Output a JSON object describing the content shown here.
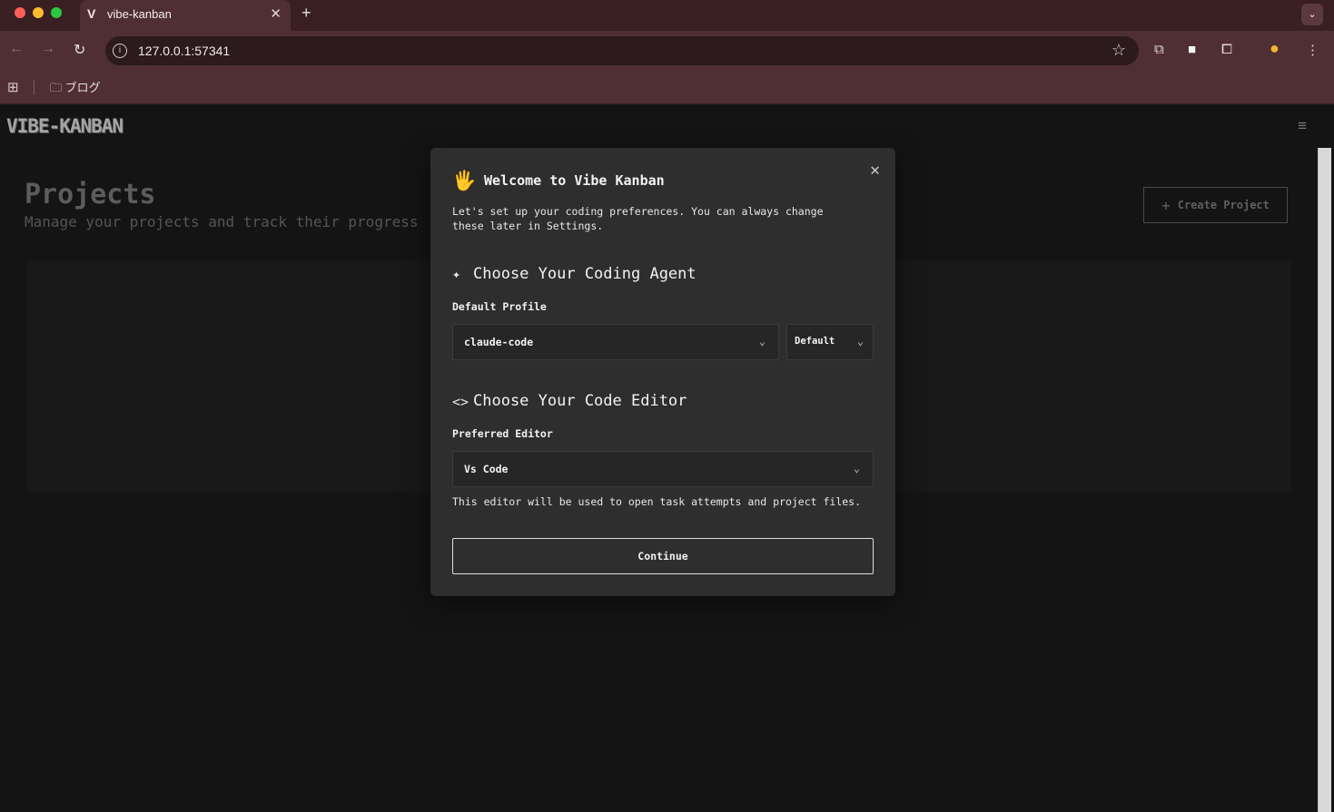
{
  "browser": {
    "colors": {
      "close": "#ff5f57",
      "minimize": "#febc2e",
      "maximize": "#28c840"
    },
    "tab": {
      "favicon": "V",
      "title": "vibe-kanban",
      "close": "✕"
    },
    "new_tab": "+",
    "tab_search": "⌄",
    "nav": {
      "back": "←",
      "forward": "→",
      "reload": "↻"
    },
    "url": "127.0.0.1:57341",
    "url_info": "i",
    "star": "☆",
    "toolbar_icons": {
      "cast": "⧉",
      "profile_square": "■",
      "extensions": "⧠",
      "avatar": "●",
      "menu": "⋮"
    },
    "bookmarks": {
      "apps": "⊞",
      "folder_icon": "🗀",
      "folder_label": "ブログ"
    }
  },
  "app": {
    "logo": "VIBE-KANBAN",
    "menu_icon": "≡",
    "page_title": "Projects",
    "page_subtitle": "Manage your projects and track their progress",
    "create_button": {
      "icon": "+",
      "label": "Create Project"
    }
  },
  "modal": {
    "close": "✕",
    "hand_icon": "🖐",
    "title": "Welcome to Vibe Kanban",
    "description": "Let's set up your coding preferences. You can always change these later in Settings.",
    "agent_section": {
      "icon": "✦",
      "title": "Choose Your Coding Agent",
      "label": "Default Profile",
      "profile_value": "claude-code",
      "variant_value": "Default"
    },
    "editor_section": {
      "icon": "<>",
      "title": "Choose Your Code Editor",
      "label": "Preferred Editor",
      "editor_value": "Vs Code",
      "help": "This editor will be used to open task attempts and project files."
    },
    "chevron": "⌄",
    "continue_label": "Continue"
  }
}
